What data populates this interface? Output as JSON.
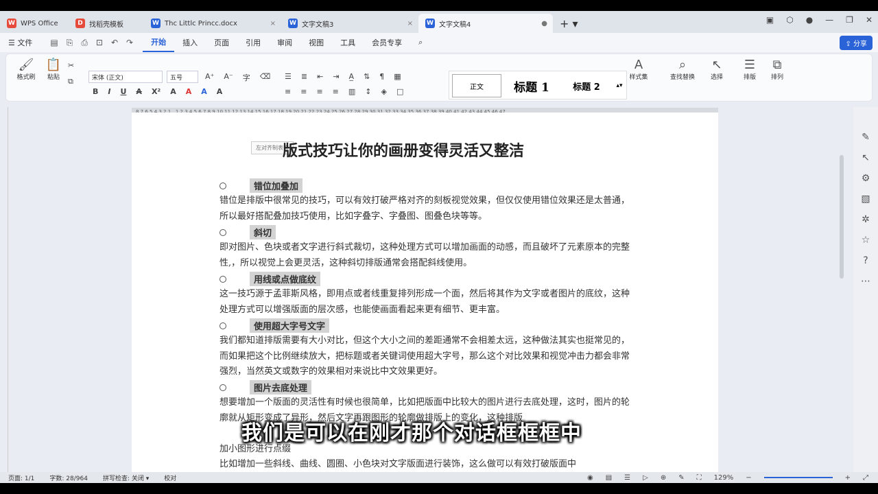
{
  "tabs": [
    {
      "label": "WPS Office",
      "color": "#e64a3b"
    },
    {
      "label": "找稻壳模板",
      "color": "#e64a3b"
    },
    {
      "label": "Thc Littlc Princc.docx",
      "color": "#2a62d8"
    },
    {
      "label": "文字文稿3",
      "color": "#2a62d8"
    },
    {
      "label": "文字文稿4",
      "color": "#2a62d8"
    }
  ],
  "menu": {
    "file": "文件",
    "items": [
      "开始",
      "插入",
      "页面",
      "引用",
      "审阅",
      "视图",
      "工具",
      "会员专享"
    ],
    "share": "分享"
  },
  "ribbon": {
    "format_painter": "格式刷",
    "paste": "粘贴",
    "font": "宋体 (正文)",
    "size": "五号",
    "styles": [
      "正文",
      "标题 1",
      "标题 2"
    ],
    "style_set": "样式集",
    "find_replace": "查找替换",
    "select": "选择",
    "layout": "排版",
    "arrange": "排列"
  },
  "ruler": "8 7 6 5 4 3 2 1 . 1 2 3 4 5 6 7 8 9 10 11 12 13 14 15 16 17 18 19 20 21 22 23 24 25 26 27 28 29 30 31 32 33 34 35 36 37 38 39 40 41 42 43 44 45 46 47",
  "document": {
    "title": "版式技巧让你的画册变得灵活又整洁",
    "tooltip": "左对齐制表符",
    "sections": [
      {
        "heading": "错位加叠加",
        "body": "错位是排版中很常见的技巧，可以有效打破严格对齐的刻板视觉效果，但仅仅使用错位效果还是太普通，所以最好搭配叠加技巧使用，比如字叠字、字叠图、图叠色块等等。"
      },
      {
        "heading": "斜切",
        "body": "即对图片、色块或者文字进行斜式裁切，这种处理方式可以增加画面的动感，而且破坏了元素原本的完整性,，所以视觉上会更灵活，这种斜切排版通常会搭配斜线使用。"
      },
      {
        "heading": "用线或点做底纹",
        "body": "这一技巧源于孟菲斯风格，即用点或者线重复排列形成一个面，然后将其作为文字或者图片的底纹，这种处理方式可以增强版面的层次感，也能使画面看起来更有细节、更丰富。"
      },
      {
        "heading": "使用超大字号文字",
        "body": "我们都知道排版需要有大小对比，但这个大小之间的差距通常不会相差太远，这种做法其实也挺常见的，而如果把这个比例继续放大，把标题或者关键词使用超大字号，那么这个对比效果和视觉冲击力都会非常强烈，当然英文或数字的效果相对来说比中文效果更好。"
      },
      {
        "heading": "图片去底处理",
        "body": "想要增加一个版面的灵活性有时候也很简单，比如把版面中比较大的图片进行去底处理，这时，图片的轮廓就从矩形变成了异形，然后文字再跟图形的轮廓做排版上的变化，这种排版"
      }
    ],
    "extra_heading": "加小图形进行点缀",
    "extra_body": "比如增加一些斜线、曲线、圆圈、小色块对文字版面进行装饰，这么做可以有效打破版面中"
  },
  "subtitle": "我们是可以在刚才那个对话框框框中",
  "status": {
    "page": "页面: 1/1",
    "words": "字数: 28/964",
    "spell": "拼写检查: 关闭 ▾",
    "proof": "校对",
    "zoom": "129%"
  }
}
